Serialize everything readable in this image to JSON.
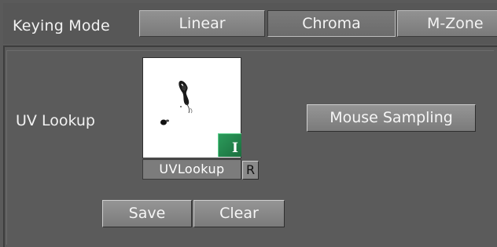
{
  "header": {
    "keying_mode_label": "Keying Mode",
    "modes": [
      "Linear",
      "Chroma",
      "M-Zone"
    ],
    "selected_mode": "Chroma"
  },
  "uv_lookup": {
    "label": "UV Lookup",
    "thumbnail_caption": "UVLookup",
    "badge_letter": "I",
    "reset_label": "R"
  },
  "buttons": {
    "mouse_sampling": "Mouse Sampling",
    "save": "Save",
    "clear": "Clear"
  },
  "colors": {
    "background": "#5a5a5a",
    "button": "#888888",
    "badge_green": "#2c9b5b",
    "text": "#f2f2f2"
  }
}
